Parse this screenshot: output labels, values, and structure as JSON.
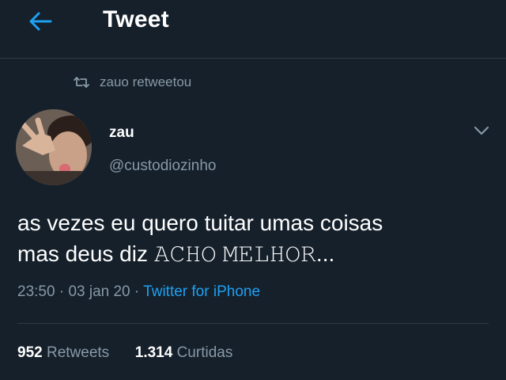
{
  "header": {
    "title": "Tweet"
  },
  "retweet": {
    "text": "zauo retweetou"
  },
  "author": {
    "name": "zau",
    "handle": "@custodiozinho"
  },
  "tweet": {
    "line1": "as vezes eu quero tuitar umas coisas",
    "line2": "mas deus diz 𝙰𝙲𝙷𝙾 𝙼𝙴𝙻𝙷𝙾𝚁..."
  },
  "meta": {
    "time": "23:50",
    "date": "03 jan 20",
    "source": "Twitter for iPhone"
  },
  "stats": {
    "retweets": "952",
    "retweets_label": "Retweets",
    "likes": "1.314",
    "likes_label": "Curtidas"
  },
  "colors": {
    "background": "#15202b",
    "accent": "#1da1f2",
    "muted": "#8899a6"
  }
}
